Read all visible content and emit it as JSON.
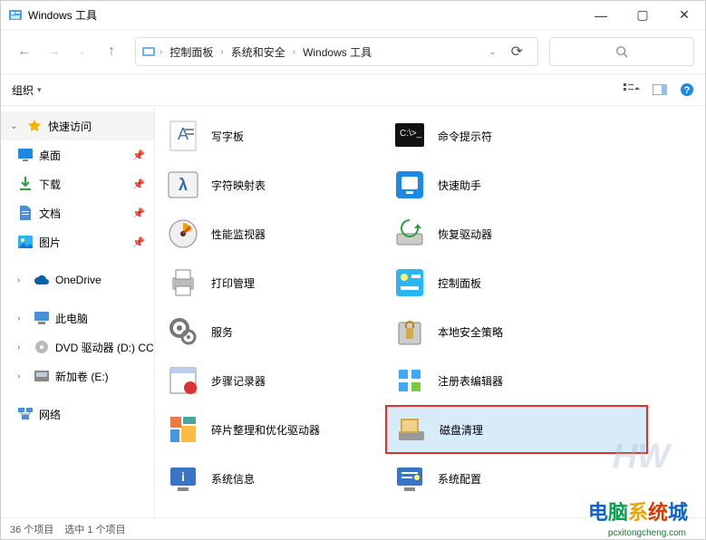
{
  "window": {
    "title": "Windows 工具"
  },
  "titlebar_buttons": {
    "min": "—",
    "max": "▢",
    "close": "✕"
  },
  "breadcrumbs": [
    "控制面板",
    "系统和安全",
    "Windows 工具"
  ],
  "toolbar": {
    "organize": "组织"
  },
  "sidebar": {
    "quick_access": "快速访问",
    "desktop": "桌面",
    "downloads": "下载",
    "documents": "文档",
    "pictures": "图片",
    "onedrive": "OneDrive",
    "this_pc": "此电脑",
    "dvd": "DVD 驱动器 (D:) CC",
    "new_volume": "新加卷 (E:)",
    "network": "网络"
  },
  "apps": {
    "col1": [
      {
        "name": "写字板"
      },
      {
        "name": "字符映射表"
      },
      {
        "name": "性能监视器"
      },
      {
        "name": "打印管理"
      },
      {
        "name": "服务"
      },
      {
        "name": "步骤记录器"
      },
      {
        "name": "碎片整理和优化驱动器"
      },
      {
        "name": "系统信息"
      }
    ],
    "col2": [
      {
        "name": "命令提示符"
      },
      {
        "name": "快速助手"
      },
      {
        "name": "恢复驱动器"
      },
      {
        "name": "控制面板"
      },
      {
        "name": "本地安全策略"
      },
      {
        "name": "注册表编辑器"
      },
      {
        "name": "磁盘清理",
        "selected": true
      },
      {
        "name": "系统配置"
      }
    ]
  },
  "statusbar": {
    "total": "36 个项目",
    "selected": "选中 1 个项目"
  },
  "watermark": {
    "hw": "HW",
    "brand": "电脑系统城",
    "url": "pcxitongcheng.com"
  }
}
